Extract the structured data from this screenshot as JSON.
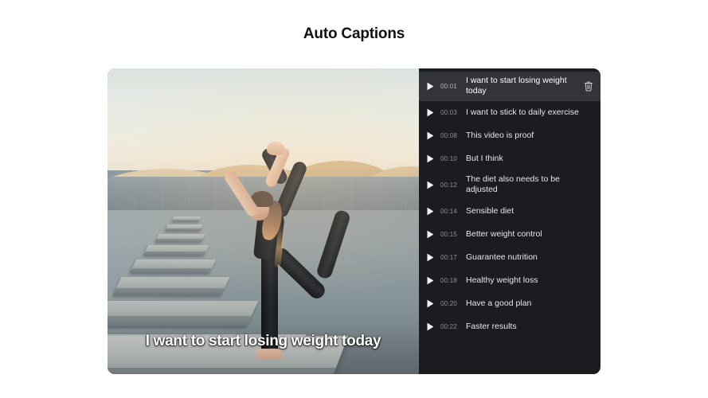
{
  "page": {
    "title": "Auto Captions",
    "background_color": "#ffffff"
  },
  "colors": {
    "panel_bg": "#1b1c20",
    "row_active_bg": "#32343a",
    "text_primary": "#e6e7e9",
    "text_muted": "#8f9298",
    "caption_overlay": "#ffffff"
  },
  "video": {
    "name": "yoga-dancer-pose-video",
    "burned_in_caption": "I want to start losing weight today",
    "scene_description": "Woman in dancer yoga pose on concrete steps at sunset"
  },
  "caption_panel": {
    "name": "caption-list",
    "rows": [
      {
        "time": "00:01",
        "text": "I want to start losing weight today",
        "active": true,
        "has_delete": true
      },
      {
        "time": "00:03",
        "text": "I want to stick to daily exercise",
        "active": false,
        "has_delete": false
      },
      {
        "time": "00:08",
        "text": "This video is proof",
        "active": false,
        "has_delete": false
      },
      {
        "time": "00:10",
        "text": "But I think",
        "active": false,
        "has_delete": false
      },
      {
        "time": "00:12",
        "text": "The diet also needs to be adjusted",
        "active": false,
        "has_delete": false
      },
      {
        "time": "00:14",
        "text": "Sensible diet",
        "active": false,
        "has_delete": false
      },
      {
        "time": "00:15",
        "text": "Better weight control",
        "active": false,
        "has_delete": false
      },
      {
        "time": "00:17",
        "text": "Guarantee nutrition",
        "active": false,
        "has_delete": false
      },
      {
        "time": "00:18",
        "text": "Healthy weight loss",
        "active": false,
        "has_delete": false
      },
      {
        "time": "00:20",
        "text": "Have a good plan",
        "active": false,
        "has_delete": false
      },
      {
        "time": "00:22",
        "text": "Faster results",
        "active": false,
        "has_delete": false
      }
    ],
    "icons": {
      "play": "play-icon",
      "delete": "trash-icon"
    }
  }
}
